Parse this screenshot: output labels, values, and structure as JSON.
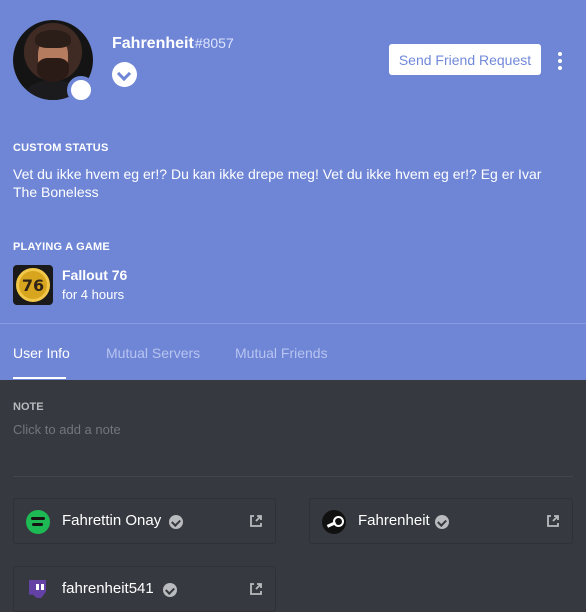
{
  "profile": {
    "username": "Fahrenheit",
    "discriminator": "#8057",
    "status_color": "#ffffff",
    "actions": {
      "send_friend_request": "Send Friend Request"
    }
  },
  "custom_status": {
    "title": "CUSTOM STATUS",
    "text": "Vet du ikke hvem eg er!? Du kan ikke drepe meg! Vet du ikke hvem eg er!? Eg er Ivar The Boneless"
  },
  "activity": {
    "title": "PLAYING A GAME",
    "game_name": "Fallout 76",
    "duration": "for 4 hours",
    "icon": "fallout-76-icon"
  },
  "tabs": [
    {
      "label": "User Info",
      "active": true
    },
    {
      "label": "Mutual Servers",
      "active": false
    },
    {
      "label": "Mutual Friends",
      "active": false
    }
  ],
  "note": {
    "label": "NOTE",
    "placeholder": "Click to add a note"
  },
  "connections": [
    {
      "service": "spotify",
      "name": "Fahrettin Onay",
      "verified": true,
      "icon": "spotify-icon"
    },
    {
      "service": "steam",
      "name": "Fahrenheit",
      "verified": true,
      "icon": "steam-icon"
    },
    {
      "service": "twitch",
      "name": "fahrenheit541",
      "verified": true,
      "icon": "twitch-icon"
    }
  ],
  "colors": {
    "header_bg": "#6f86d6",
    "body_bg": "#36393f",
    "accent": "#7289da"
  }
}
